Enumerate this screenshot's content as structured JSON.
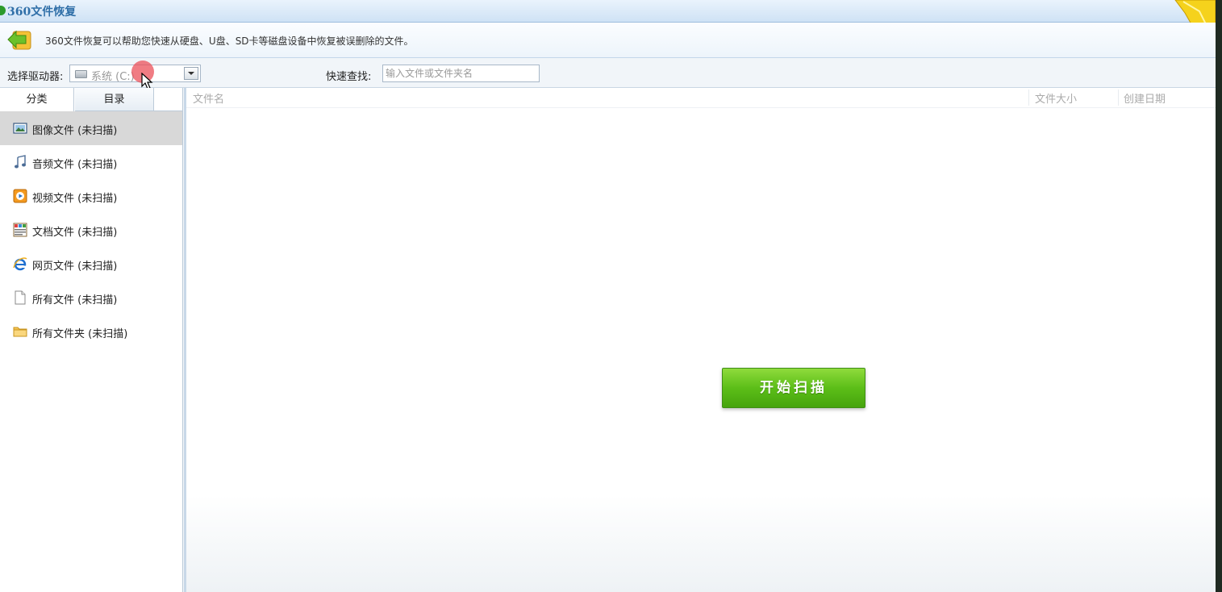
{
  "window": {
    "title": "360文件恢复"
  },
  "info_bar": {
    "text": "360文件恢复可以帮助您快速从硬盘、U盘、SD卡等磁盘设备中恢复被误删除的文件。"
  },
  "toolbar": {
    "drive_label": "选择驱动器:",
    "drive_value": "系统 (C:)",
    "search_label": "快速查找:",
    "search_placeholder": "输入文件或文件夹名",
    "search_value": ""
  },
  "left_panel": {
    "tabs": [
      {
        "label": "分类",
        "active": true
      },
      {
        "label": "目录",
        "active": false
      }
    ],
    "categories": [
      {
        "label": "图像文件 (未扫描)",
        "icon": "image-icon",
        "selected": true
      },
      {
        "label": "音频文件 (未扫描)",
        "icon": "music-note-icon",
        "selected": false
      },
      {
        "label": "视频文件 (未扫描)",
        "icon": "video-icon",
        "selected": false
      },
      {
        "label": "文档文件 (未扫描)",
        "icon": "document-icon",
        "selected": false
      },
      {
        "label": "网页文件 (未扫描)",
        "icon": "ie-icon",
        "selected": false
      },
      {
        "label": "所有文件 (未扫描)",
        "icon": "blank-file-icon",
        "selected": false
      },
      {
        "label": "所有文件夹 (未扫描)",
        "icon": "folder-icon",
        "selected": false
      }
    ]
  },
  "file_list": {
    "columns": [
      "文件名",
      "文件大小",
      "创建日期"
    ]
  },
  "actions": {
    "start_scan": "开始扫描"
  },
  "colors": {
    "title_blue": "#2f6fa8",
    "scan_button_green": "#5cbe18",
    "selected_row": "#d8d8d8"
  }
}
